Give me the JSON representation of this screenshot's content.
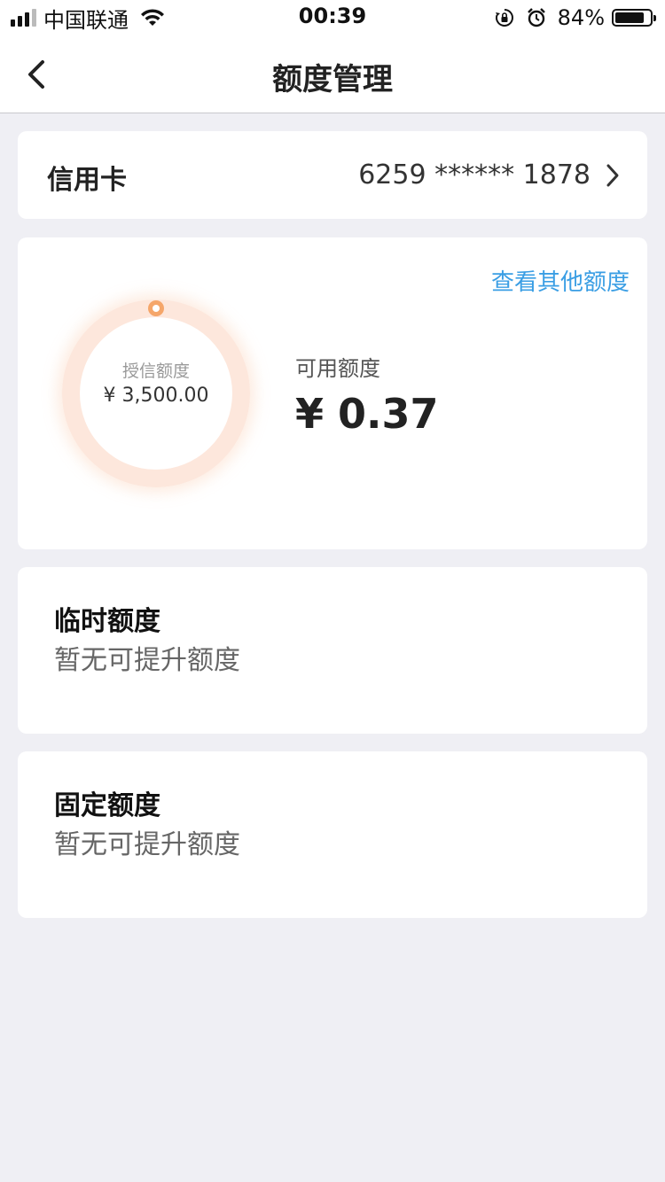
{
  "status_bar": {
    "carrier": "中国联通",
    "time": "00:39",
    "battery_percent": "84%",
    "battery_level": 0.84
  },
  "nav": {
    "title": "额度管理"
  },
  "credit_card": {
    "label": "信用卡",
    "number": "6259 ****** 1878"
  },
  "limit": {
    "view_other": "查看其他额度",
    "granted_label": "授信额度",
    "granted_value": "¥ 3,500.00",
    "available_label": "可用额度",
    "available_value": "¥ 0.37",
    "ring_color": "#fde7dc",
    "marker_color": "#f5a66a"
  },
  "temporary": {
    "title": "临时额度",
    "subtitle": "暂无可提升额度"
  },
  "fixed": {
    "title": "固定额度",
    "subtitle": "暂无可提升额度"
  },
  "colors": {
    "accent": "#3a9ee4",
    "background": "#efeff4"
  }
}
